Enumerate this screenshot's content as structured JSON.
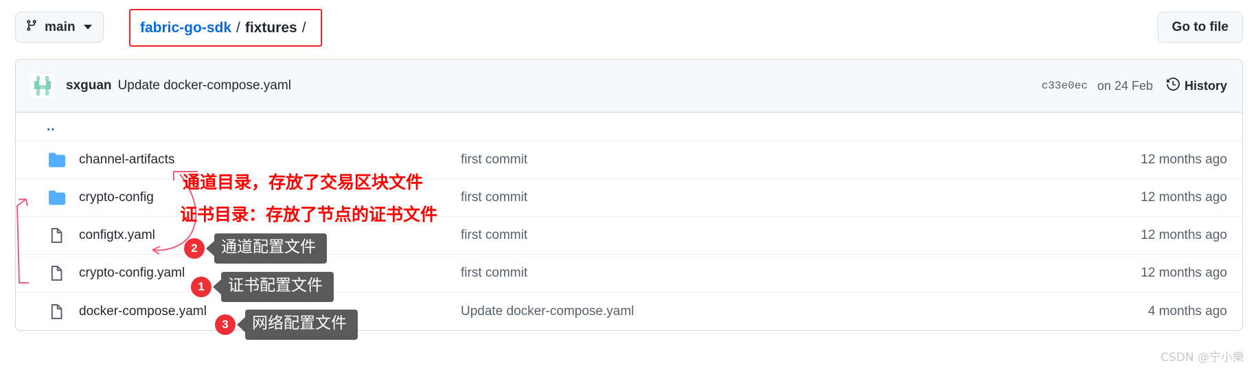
{
  "toolbar": {
    "branch_name": "main",
    "branch_icon": "git-branch-icon",
    "caret_icon": "chevron-down-icon",
    "goto_file_label": "Go to file",
    "breadcrumb": {
      "repo": "fabric-go-sdk",
      "separator": "/",
      "directory": "fixtures",
      "trailing_separator": "/",
      "highlight_color": "#f5222d"
    }
  },
  "commit_header": {
    "avatar_name": "user-avatar",
    "author": "sxguan",
    "message": "Update docker-compose.yaml",
    "sha": "c33e0ec",
    "date": "on 24 Feb",
    "history_label": "History",
    "history_icon": "history-clock-icon"
  },
  "file_list": {
    "parent_dir_label": "..",
    "rows": [
      {
        "icon": "folder-icon",
        "type": "folder",
        "name": "channel-artifacts",
        "commit_message": "first commit",
        "age": "12 months ago"
      },
      {
        "icon": "folder-icon",
        "type": "folder",
        "name": "crypto-config",
        "commit_message": "first commit",
        "age": "12 months ago"
      },
      {
        "icon": "file-icon",
        "type": "file",
        "name": "configtx.yaml",
        "commit_message": "first commit",
        "age": "12 months ago"
      },
      {
        "icon": "file-icon",
        "type": "file",
        "name": "crypto-config.yaml",
        "commit_message": "first commit",
        "age": "12 months ago"
      },
      {
        "icon": "file-icon",
        "type": "file",
        "name": "docker-compose.yaml",
        "commit_message": "Update docker-compose.yaml",
        "age": "4 months ago"
      }
    ]
  },
  "annotations": {
    "red_notes": [
      {
        "text": "通道目录，存放了交易区块文件",
        "color": "#ff0000"
      },
      {
        "text": "证书目录：存放了节点的证书文件",
        "color": "#ff0000"
      }
    ],
    "callouts": [
      {
        "badge": "2",
        "text": "通道配置文件",
        "badge_color": "#ee2f35",
        "box_color": "#5a5a5a"
      },
      {
        "badge": "1",
        "text": "证书配置文件",
        "badge_color": "#ee2f35",
        "box_color": "#5a5a5a"
      },
      {
        "badge": "3",
        "text": "网络配置文件",
        "badge_color": "#ee2f35",
        "box_color": "#5a5a5a"
      }
    ],
    "arrow_color": "#e8607a"
  },
  "watermark": "CSDN @宁小樂"
}
